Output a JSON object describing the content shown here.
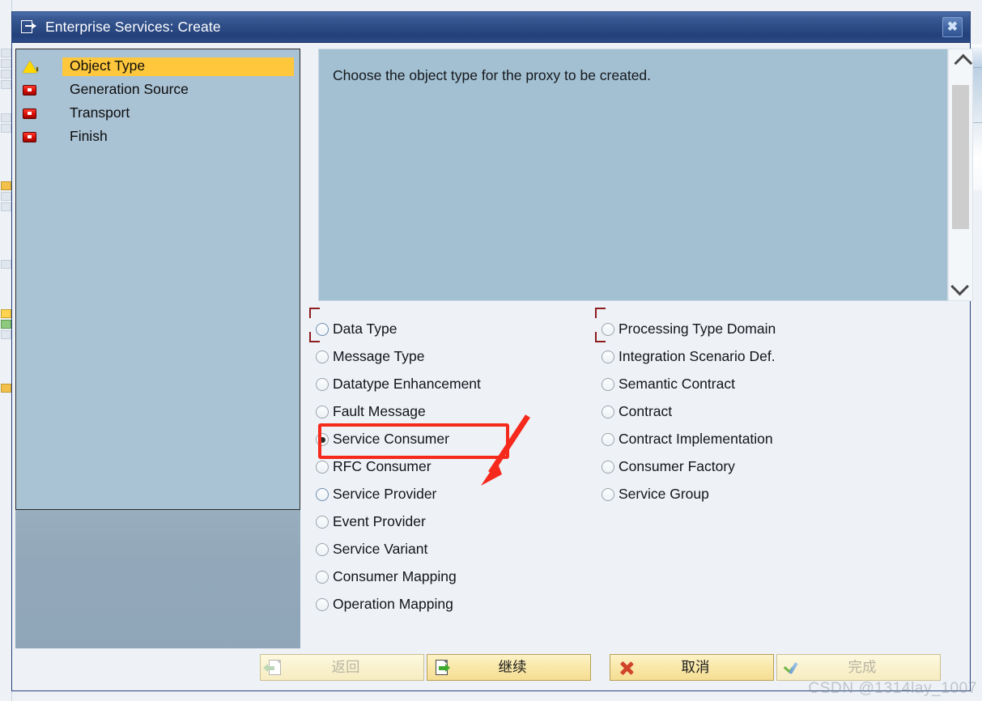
{
  "window": {
    "title": "Enterprise Services: Create",
    "title_icon": "export-object-icon",
    "close_label": "✖"
  },
  "sidebar": {
    "items": [
      {
        "label": "Object Type",
        "icon": "warning-triangle-icon",
        "state": "active"
      },
      {
        "label": "Generation Source",
        "icon": "red-square-icon",
        "state": "pending"
      },
      {
        "label": "Transport",
        "icon": "red-square-icon",
        "state": "pending"
      },
      {
        "label": "Finish",
        "icon": "red-square-icon",
        "state": "pending"
      }
    ]
  },
  "info": {
    "text": "Choose the object type for the proxy to be created."
  },
  "scrollbar": {
    "up_icon": "chevron-up-icon",
    "down_icon": "chevron-down-icon"
  },
  "object_types": {
    "left_column": [
      {
        "label": "Data Type",
        "checked": false,
        "focused": true
      },
      {
        "label": "Message Type",
        "checked": false,
        "focused": false
      },
      {
        "label": "Datatype Enhancement",
        "checked": false,
        "focused": false
      },
      {
        "label": "Fault Message",
        "checked": false,
        "focused": false
      },
      {
        "label": "Service Consumer",
        "checked": true,
        "focused": false
      },
      {
        "label": "RFC Consumer",
        "checked": false,
        "focused": false
      },
      {
        "label": "Service Provider",
        "checked": false,
        "focused": false
      },
      {
        "label": "Event Provider",
        "checked": false,
        "focused": false
      },
      {
        "label": "Service Variant",
        "checked": false,
        "focused": false
      },
      {
        "label": "Consumer Mapping",
        "checked": false,
        "focused": false
      },
      {
        "label": "Operation Mapping",
        "checked": false,
        "focused": false
      }
    ],
    "right_column": [
      {
        "label": "Processing Type Domain",
        "checked": false,
        "focused": true
      },
      {
        "label": "Integration Scenario Def.",
        "checked": false,
        "focused": false
      },
      {
        "label": "Semantic Contract",
        "checked": false,
        "focused": false
      },
      {
        "label": "Contract",
        "checked": false,
        "focused": false
      },
      {
        "label": "Contract Implementation",
        "checked": false,
        "focused": false
      },
      {
        "label": "Consumer Factory",
        "checked": false,
        "focused": false
      },
      {
        "label": "Service Group",
        "checked": false,
        "focused": false
      }
    ],
    "selected": "Service Consumer"
  },
  "annotation": {
    "highlight_target": "Service Consumer",
    "color": "#f5291c"
  },
  "buttons": [
    {
      "label": "返回",
      "icon": "back-document-icon",
      "disabled": true
    },
    {
      "label": "继续",
      "icon": "next-document-icon",
      "disabled": false
    },
    {
      "label": "取消",
      "icon": "cancel-x-icon",
      "disabled": false
    },
    {
      "label": "完成",
      "icon": "finish-check-icon",
      "disabled": true
    }
  ],
  "watermark": {
    "text": "CSDN @1314lay_1007"
  }
}
